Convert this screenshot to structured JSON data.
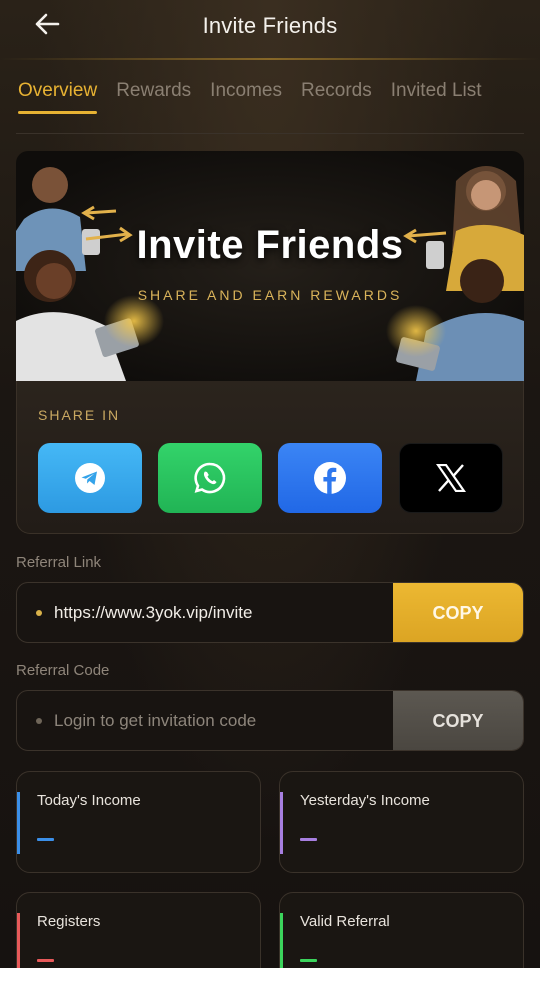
{
  "header": {
    "title": "Invite Friends"
  },
  "tabs": [
    {
      "label": "Overview",
      "active": true
    },
    {
      "label": "Rewards"
    },
    {
      "label": "Incomes"
    },
    {
      "label": "Records"
    },
    {
      "label": "Invited List"
    }
  ],
  "banner": {
    "title": "Invite Friends",
    "subtitle": "SHARE AND EARN REWARDS"
  },
  "share": {
    "label": "SHARE IN",
    "buttons": [
      {
        "name": "telegram",
        "icon": "telegram-icon",
        "color": "#3aa9ee"
      },
      {
        "name": "whatsapp",
        "icon": "whatsapp-icon",
        "color": "#25c35c"
      },
      {
        "name": "facebook",
        "icon": "facebook-icon",
        "color": "#2f78ee"
      },
      {
        "name": "x",
        "icon": "x-icon",
        "color": "#000000"
      }
    ]
  },
  "referral_link": {
    "label": "Referral Link",
    "value": "https://www.3yok.vip/invite",
    "copy_label": "COPY"
  },
  "referral_code": {
    "label": "Referral Code",
    "value": "Login to get invitation code",
    "copy_label": "COPY"
  },
  "stats": [
    {
      "label": "Today's Income",
      "value": "—",
      "color": "#3b8fe8"
    },
    {
      "label": "Yesterday's Income",
      "value": "—",
      "color": "#a77fe0"
    },
    {
      "label": "Registers",
      "value": "—",
      "color": "#e85a5a"
    },
    {
      "label": "Valid Referral",
      "value": "—",
      "color": "#3bd45c"
    }
  ],
  "colors": {
    "accent": "#e7b233",
    "background": "#1c1713"
  }
}
